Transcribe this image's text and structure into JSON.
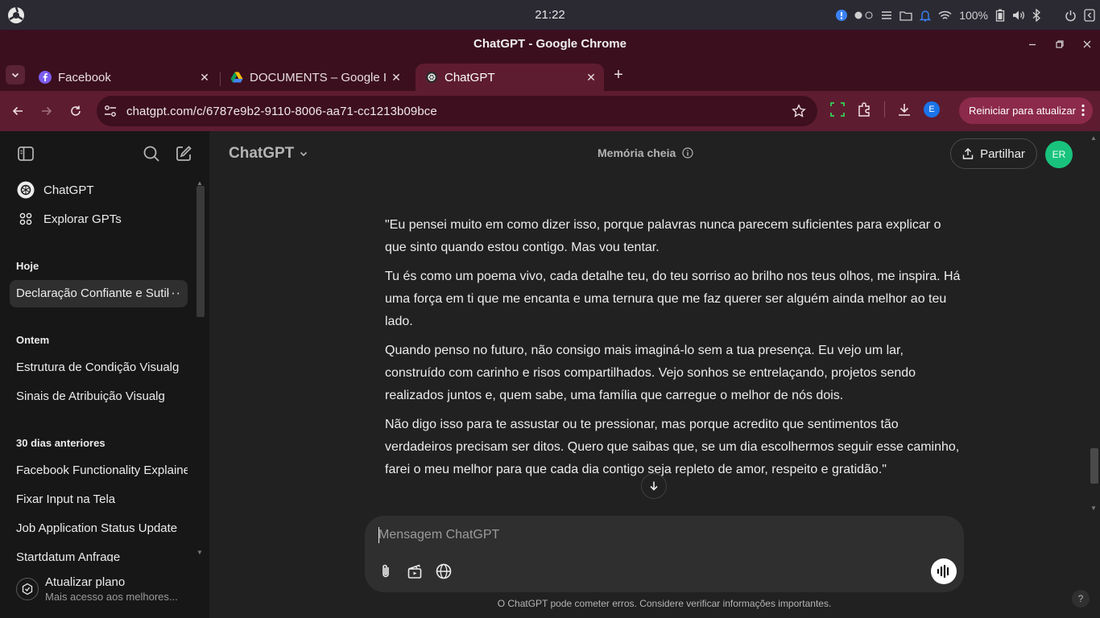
{
  "os": {
    "clock": "21:22",
    "battery": "100%"
  },
  "window": {
    "title": "ChatGPT - Google Chrome"
  },
  "tabs": [
    {
      "label": "Facebook",
      "icon": "facebook-icon"
    },
    {
      "label": "DOCUMENTS – Google I",
      "icon": "google-drive-icon"
    },
    {
      "label": "ChatGPT",
      "icon": "chatgpt-icon"
    }
  ],
  "toolbar": {
    "url": "chatgpt.com/c/6787e9b2-9110-8006-aa71-cc1213b09bce",
    "restart_label": "Reiniciar para atualizar",
    "profile_initial": "E"
  },
  "sidebar": {
    "nav": [
      {
        "label": "ChatGPT"
      },
      {
        "label": "Explorar GPTs"
      }
    ],
    "groups": [
      {
        "heading": "Hoje",
        "items": [
          "Declaração Confiante e Sutil"
        ]
      },
      {
        "heading": "Ontem",
        "items": [
          "Estrutura de Condição Visualg",
          "Sinais de Atribuição Visualg"
        ]
      },
      {
        "heading": "30 dias anteriores",
        "items": [
          "Facebook Functionality Explained",
          "Fixar Input na Tela",
          "Job Application Status Update",
          "Startdatum Anfrage"
        ]
      }
    ],
    "more_glyph": "···",
    "upgrade": {
      "title": "Atualizar plano",
      "subtitle": "Mais acesso aos melhores..."
    }
  },
  "main": {
    "model": "ChatGPT",
    "memory": "Memória cheia",
    "share": "Partilhar",
    "avatar": "ER",
    "paragraphs": [
      "\"Eu pensei muito em como dizer isso, porque palavras nunca parecem suficientes para explicar o que sinto quando estou contigo. Mas vou tentar.",
      "Tu és como um poema vivo, cada detalhe teu, do teu sorriso ao brilho nos teus olhos, me inspira. Há uma força em ti que me encanta e uma ternura que me faz querer ser alguém ainda melhor ao teu lado.",
      "Quando penso no futuro, não consigo mais imaginá-lo sem a tua presença. Eu vejo um lar, construído com carinho e risos compartilhados. Vejo sonhos se entrelaçando, projetos sendo realizados juntos e, quem sabe, uma família que carregue o melhor de nós dois.",
      "Não digo isso para te assustar ou te pressionar, mas porque acredito que sentimentos tão verdadeiros precisam ser ditos. Quero que saibas que, se um dia escolhermos seguir esse caminho, farei o meu melhor para que cada dia contigo seja repleto de amor, respeito e gratidão.\""
    ],
    "composer_placeholder": "Mensagem ChatGPT",
    "disclaimer": "O ChatGPT pode cometer erros. Considere verificar informações importantes.",
    "help": "?"
  },
  "colors": {
    "accent_green": "#19c37d",
    "chrome_frame": "#3b0f1e",
    "chrome_toolbar": "#5e1c30",
    "restart_btn": "#8c2a4b"
  }
}
